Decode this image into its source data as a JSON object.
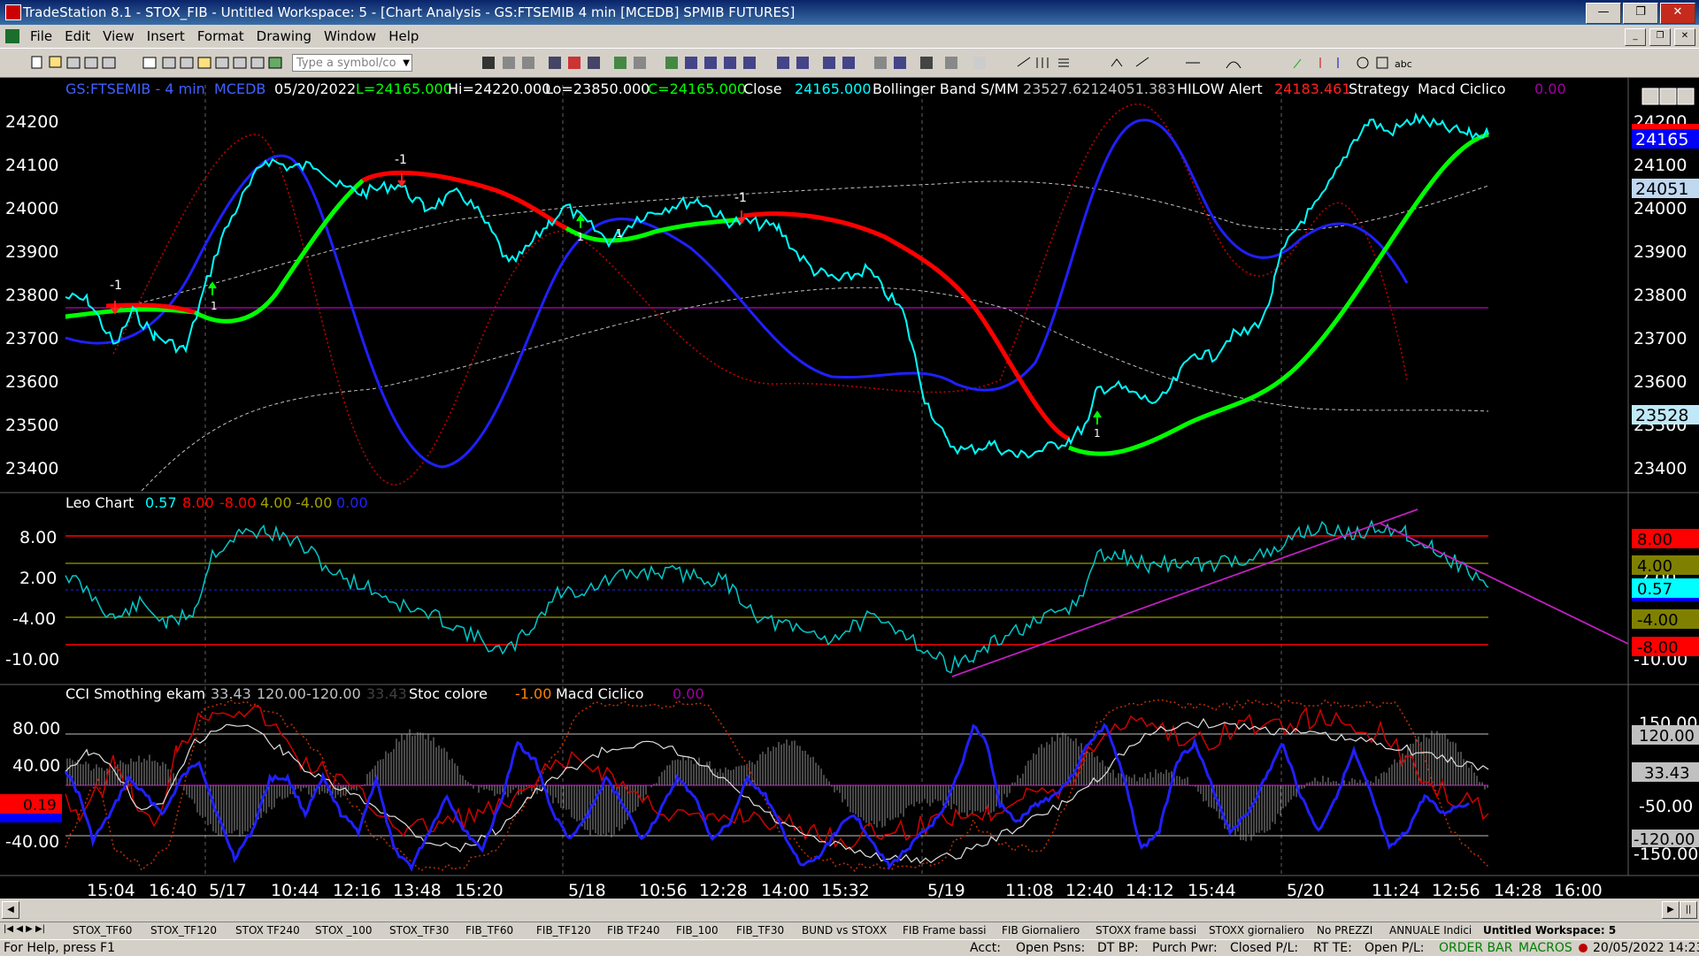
{
  "window": {
    "title": "TradeStation 8.1 - STOX_FIB - Untitled Workspace:  5 - [Chart Analysis - GS:FTSEMIB  4 min  [MCEDB] SPMIB FUTURES]"
  },
  "menu": [
    "File",
    "Edit",
    "View",
    "Insert",
    "Format",
    "Drawing",
    "Window",
    "Help"
  ],
  "toolbar": {
    "symbol_placeholder": "Type a symbol/co"
  },
  "chart": {
    "header": {
      "symbol": "GS:FTSEMIB - 4 min",
      "feed": "MCEDB",
      "date": "05/20/2022",
      "last": "L=24165.000",
      "hi": "Hi=24220.000",
      "lo": "Lo=23850.000",
      "close_c": "C=24165.000",
      "close_label": "Close",
      "close_val": "24165.000",
      "bb_label": "Bollinger Band S/MM",
      "bb_val1": "23527.621",
      "bb_val2": "24051.383",
      "hilow_label": "HILOW Alert",
      "hilow_val": "24183.461",
      "strategy": "Strategy",
      "macd": "Macd Ciclico",
      "macd_val": "0.00"
    },
    "price_axis": [
      "24200",
      "24100",
      "24000",
      "23900",
      "23800",
      "23700",
      "23600",
      "23500",
      "23400"
    ],
    "price_tags": [
      {
        "text": "24165",
        "bg": "#0000ff",
        "fg": "#ffffff"
      },
      {
        "text": "24051",
        "bg": "#c0d8f0",
        "fg": "#000000"
      },
      {
        "text": "23528",
        "bg": "#c0e8f8",
        "fg": "#000000"
      }
    ],
    "leo": {
      "label": "Leo Chart",
      "v1": "0.57",
      "v2": "8.00",
      "v3": "-8.00",
      "v4": "4.00",
      "v5": "-4.00",
      "v6": "0.00",
      "axis": [
        "8.00",
        "2.00",
        "-4.00",
        "-10.00"
      ],
      "tags": [
        {
          "text": "8.00",
          "bg": "#ff0000",
          "fg": "#000000"
        },
        {
          "text": "4.00",
          "bg": "#808000",
          "fg": "#000000"
        },
        {
          "text": "0.57",
          "bg": "#00ffff",
          "fg": "#000000"
        },
        {
          "text": "-4.00",
          "bg": "#808000",
          "fg": "#000000"
        },
        {
          "text": "-8.00",
          "bg": "#ff0000",
          "fg": "#000000"
        }
      ]
    },
    "cci": {
      "label": "CCI Smothing ekam",
      "v1": "33.43",
      "v2": "120.00",
      "v3": "-120.00",
      "v4": "33.43",
      "stoc_label": "Stoc colore",
      "stoc_val": "-1.00",
      "macd_label": "Macd Ciclico",
      "macd_val": "0.00",
      "axis": [
        "80.00",
        "40.00",
        "-40.00"
      ],
      "right_axis": [
        "150.00",
        "120.00",
        "33.43",
        "-50.00",
        "-120.00",
        "-150.00"
      ],
      "left_tag": "0.19"
    },
    "time_axis": [
      "15:04",
      "16:40",
      "5/17",
      "10:44",
      "12:16",
      "13:48",
      "15:20",
      "5/18",
      "10:56",
      "12:28",
      "14:00",
      "15:32",
      "5/19",
      "11:08",
      "12:40",
      "14:12",
      "15:44",
      "5/20",
      "11:24",
      "12:56",
      "14:28",
      "16:00"
    ],
    "markers": [
      "-1",
      "-1",
      "-1",
      "1",
      "1",
      "1",
      "1"
    ]
  },
  "tabs": [
    "STOX_TF60",
    "STOX_TF120",
    "STOX TF240",
    "STOX _100",
    "STOX_TF30",
    "FIB_TF60",
    "FIB_TF120",
    "FIB TF240",
    "FIB_100",
    "FIB_TF30",
    "BUND vs STOXX",
    "FIB Frame bassi",
    "FIB Giornaliero",
    "STOXX frame bassi",
    "STOXX giornaliero",
    "No PREZZI",
    "ANNUALE Indici",
    "Untitled Workspace: 5"
  ],
  "status": {
    "help": "For Help, press F1",
    "acct": "Acct:",
    "open_psns": "Open Psns:",
    "dt_bp": "DT BP:",
    "purch_pwr": "Purch Pwr:",
    "closed_pl": "Closed P/L:",
    "rt_te": "RT TE:",
    "open_pl": "Open P/L:",
    "order_bar": "ORDER BAR",
    "macros": "MACROS",
    "datetime": "20/05/2022 14:23"
  },
  "colors": {
    "up": "#00ff00",
    "down": "#ff0000",
    "price": "#00ffff",
    "cycle": "#2020ff",
    "envelope": "#ff0000",
    "trendline": "#c020c0"
  }
}
